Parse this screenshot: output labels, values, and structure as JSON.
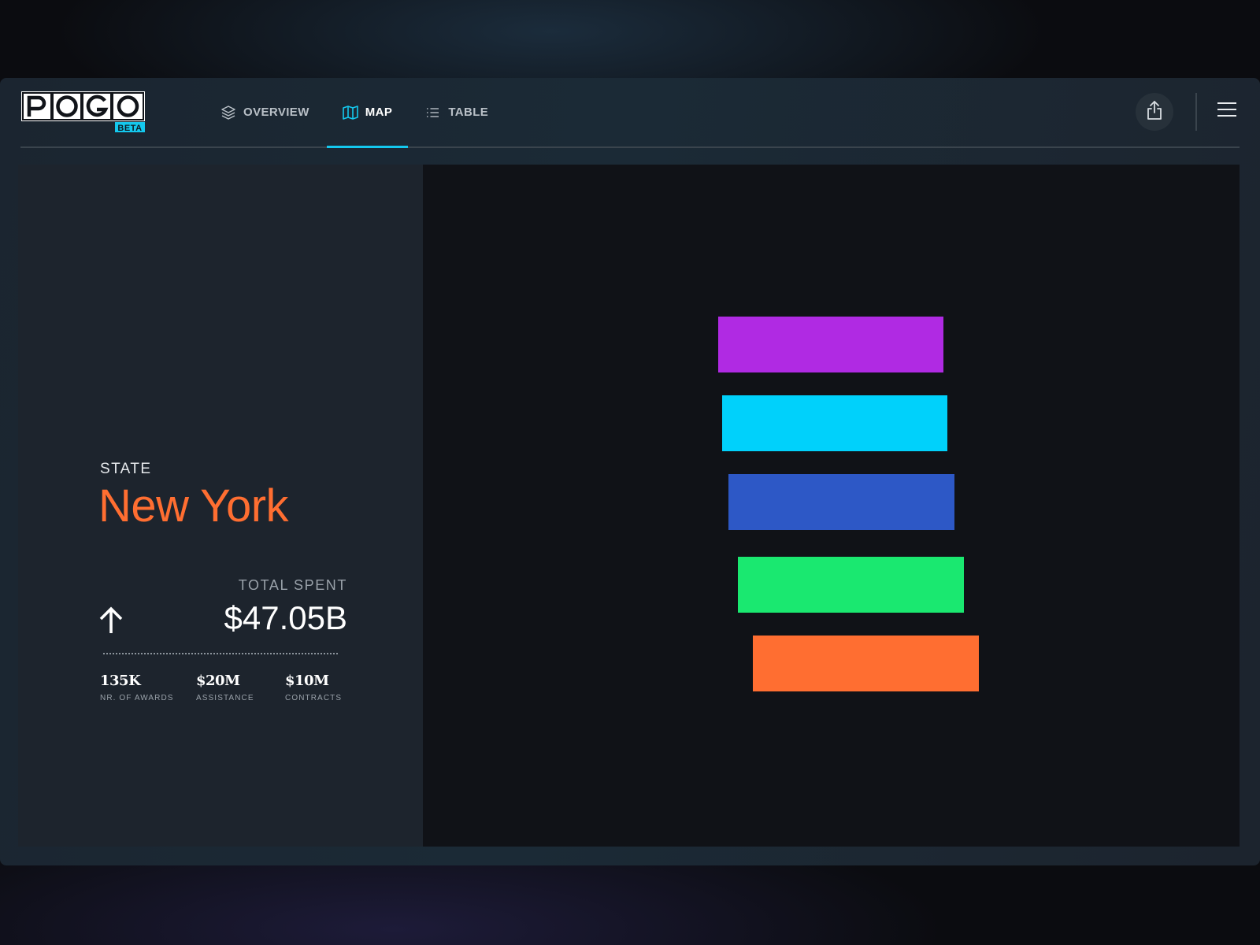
{
  "app": {
    "logo_text": "POGO",
    "logo_badge": "BETA"
  },
  "nav": {
    "tabs": [
      {
        "label": "OVERVIEW",
        "icon": "layers-icon",
        "active": false
      },
      {
        "label": "MAP",
        "icon": "map-icon",
        "active": true
      },
      {
        "label": "TABLE",
        "icon": "list-icon",
        "active": false
      }
    ]
  },
  "header": {
    "share_icon": "share-icon",
    "menu_icon": "hamburger-menu-icon"
  },
  "summary": {
    "state_label": "STATE",
    "state_name": "New York",
    "total_label": "TOTAL SPENT",
    "total_value": "$47.05B",
    "trend_icon": "arrow-up-icon",
    "stats": [
      {
        "value": "135K",
        "label": "NR. OF AWARDS"
      },
      {
        "value": "$20M",
        "label": "ASSISTANCE"
      },
      {
        "value": "$10M",
        "label": "CONTRACTS"
      }
    ]
  },
  "map": {
    "shapes": [
      {
        "name": "purple-block",
        "color": "#b02ae3"
      },
      {
        "name": "cyan-block",
        "color": "#00d1fb"
      },
      {
        "name": "blue-block",
        "color": "#2d58c6"
      },
      {
        "name": "green-block",
        "color": "#1ae870"
      },
      {
        "name": "orange-block",
        "color": "#ff6e31"
      }
    ]
  },
  "colors": {
    "accent": "#14c8ee",
    "state_highlight": "#ff6e31",
    "panel_bg": "#1d242d",
    "map_bg": "#101217"
  }
}
